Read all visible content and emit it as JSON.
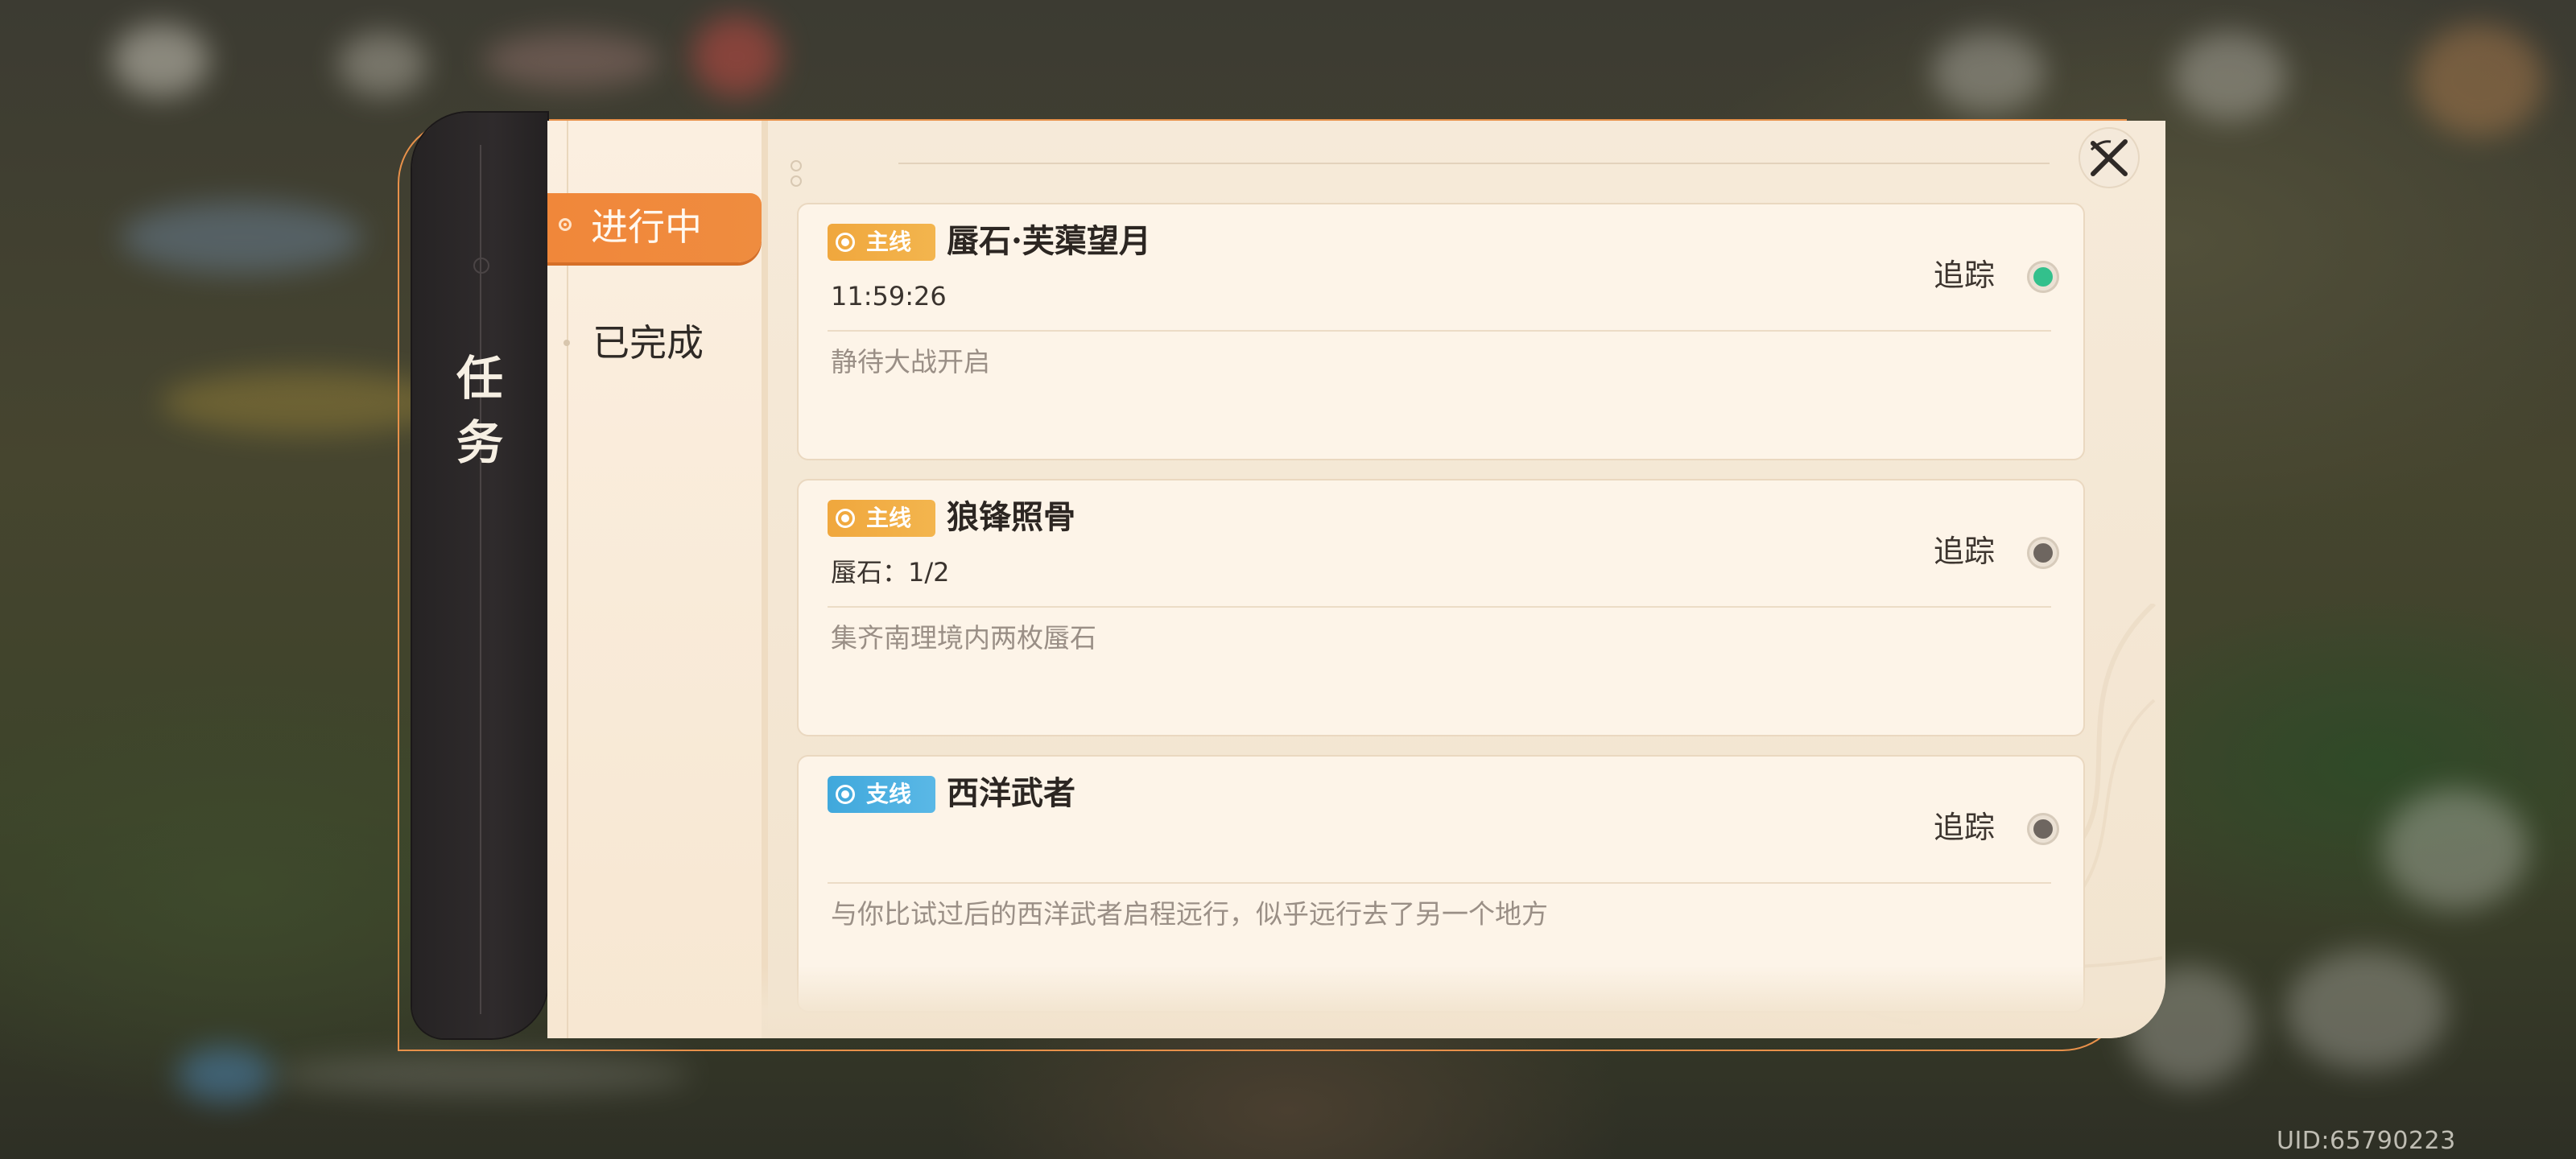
{
  "window": {
    "uid": "UID:65790223"
  },
  "sidebar": {
    "title_line1": "任",
    "title_line2": "务"
  },
  "tabs": [
    {
      "label": "进行中",
      "active": true
    },
    {
      "label": "已完成",
      "active": false
    }
  ],
  "quests": [
    {
      "type": "主线",
      "type_color": "#f0a73d",
      "title": "蜃石·芙蕖望月",
      "subtitle": "11:59:26",
      "description": "静待大战开启",
      "track_label": "追踪",
      "tracked": true
    },
    {
      "type": "主线",
      "type_color": "#f0a73d",
      "title": "狼锋照骨",
      "subtitle": "蜃石：1/2",
      "description": "集齐南理境内两枚蜃石",
      "track_label": "追踪",
      "tracked": false
    },
    {
      "type": "支线",
      "type_color": "#40a8dc",
      "title": "西洋武者",
      "subtitle": "",
      "description": "与你比试过后的西洋武者启程远行，似乎远行去了另一个地方",
      "track_label": "追踪",
      "tracked": false
    }
  ],
  "colors": {
    "accent": "#f0873a",
    "tracked": "#33c08c",
    "panel": "#f6ead9"
  },
  "icons": {
    "close": "close-icon",
    "track": "track-toggle-icon"
  }
}
